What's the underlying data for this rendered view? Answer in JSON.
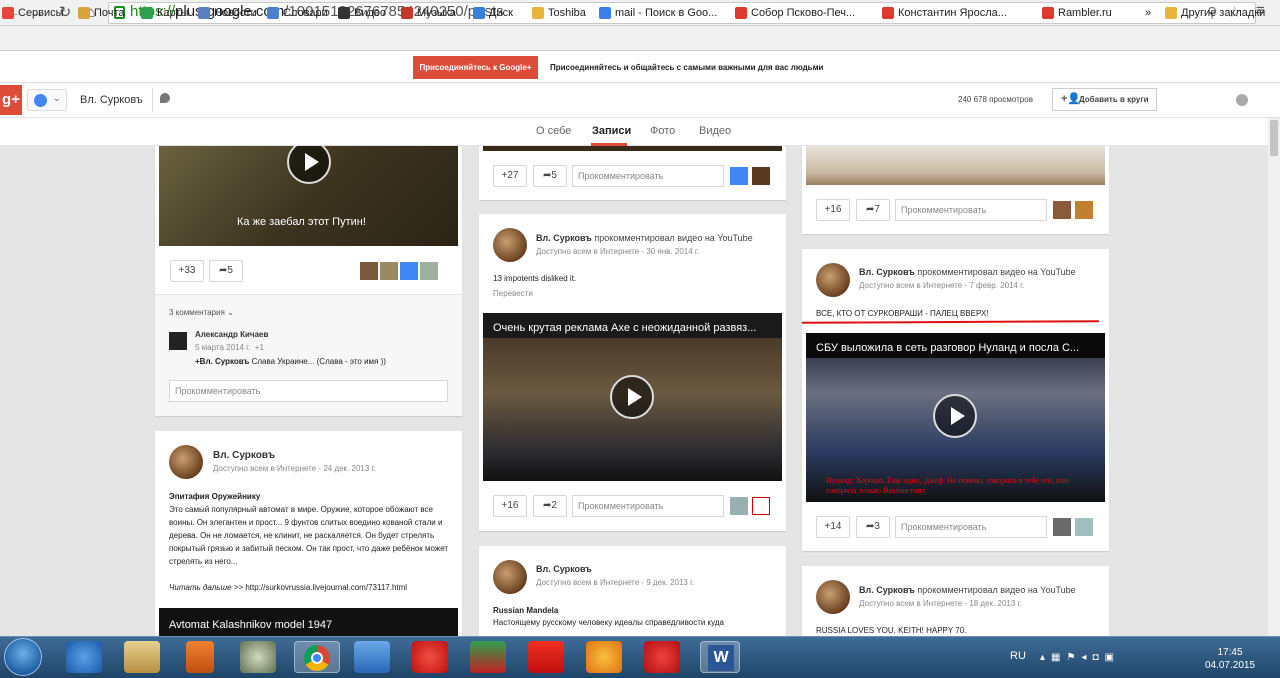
{
  "browser": {
    "url_https": "https://",
    "url_host": "plus.google.com",
    "url_path": "/100151326767854240250/posts",
    "bookmarks": [
      {
        "label": "Сервисы",
        "color": "#e8453c"
      },
      {
        "label": "Почта",
        "color": "#d9a43b"
      },
      {
        "label": "Карты",
        "color": "#2ea14f"
      },
      {
        "label": "Новости",
        "color": "#5b7fbf"
      },
      {
        "label": "Словари",
        "color": "#4a7fd4"
      },
      {
        "label": "Видео",
        "color": "#333333"
      },
      {
        "label": "Музыка",
        "color": "#c0392b"
      },
      {
        "label": "Диск",
        "color": "#3d7fd6"
      },
      {
        "label": "Toshiba",
        "color": "#e8b53c"
      },
      {
        "label": "mail - Поиск в Goo...",
        "color": "#3c7ee8"
      },
      {
        "label": "Собор Псково-Печ...",
        "color": "#e03a2e"
      },
      {
        "label": "Константин Яросла...",
        "color": "#e03a2e"
      },
      {
        "label": "Rambler.ru",
        "color": "#e03a2e"
      }
    ],
    "more_bookmarks": "»",
    "other_bookmarks": "Другие закладки"
  },
  "gplus": {
    "join_button": "Присоединяйтесь к Google+",
    "join_text": "Присоединяйтесь и общайтесь с самыми важными для вас людьми",
    "logo": "g+",
    "profile_name": "Вл. Сурковъ",
    "views": "240 678 просмотров",
    "add_to_circles": "Добавить в круги",
    "tabs": [
      "О себе",
      "Записи",
      "Фото",
      "Видео"
    ]
  },
  "col1": {
    "video1_caption": "Ка же заебал этот Путин!",
    "plus_count": "+33",
    "share_count": "5",
    "comments_count": "3 комментария",
    "commenter": "Александр Кичаев",
    "comment_date": "5 марта 2014 г.",
    "comment_plus": "+1",
    "comment_mention": "+Вл. Сурковъ",
    "comment_text": "Слава Украине... (Слава - это имя ))",
    "comment_placeholder": "Прокомментировать",
    "post2_author": "Вл. Сурковъ",
    "post2_meta": "Доступно всем в Интернете - 24 дек. 2013 г.",
    "post2_title": "Эпитафия Оружейнику",
    "post2_text": "Это самый популярный автомат в мире. Оружие, которое обожают все воины. Он элегантен и прост... 9 фунтов слитых воедино кованой стали и дерева. Он не ломается, не клинит, не раскаляется. Он будет стрелять покрытый грязью и забитый песком. Он так прост, что даже ребёнок может стрелять из него...",
    "read_more": "Читать дальше",
    "read_more_link": ">> http://surkovrussia.livejournal.com/73117.html",
    "post2_video_title": "Avtomat Kalashnikov model 1947"
  },
  "col2": {
    "top_plus": "+27",
    "top_share": "5",
    "comment_placeholder": "Прокомментировать",
    "post1_author": "Вл. Сурковъ",
    "post1_action": "прокомментировал видео на YouTube",
    "post1_meta": "Доступно всем в Интернете - 30 янв. 2014 г.",
    "post1_text": "13 impotents disliked it.",
    "translate": "Перевести",
    "post1_video_title": "Очень крутая реклама Axe с неожиданной развяз...",
    "post1_plus": "+16",
    "post1_share": "2",
    "post2_author": "Вл. Сурковъ",
    "post2_meta": "Доступно всем в Интернете - 9 дек. 2013 г.",
    "post2_title": "Russian Mandela",
    "post2_text": "Настоящему русскому человеку идеалы справедливости куда"
  },
  "col3": {
    "top_plus": "+16",
    "top_share": "7",
    "comment_placeholder": "Прокомментировать",
    "post1_author": "Вл. Сурковъ",
    "post1_action": "прокомментировал видео на YouTube",
    "post1_meta": "Доступно всем в Интернете - 7 февр. 2014 г.",
    "post1_text": "ВСЕ, КТО ОТ СУРКОВРАШИ - ПАЛЕЦ ВВЕРХ!",
    "post1_video_title": "СБУ выложила в сеть разговор Нуланд и посла С...",
    "post1_video_sub": "Нуланд: Хорошо. Еще одно, Джеф. Не помню, говорила я тебе это, или говорила только Вашингтону.",
    "post1_plus": "+14",
    "post1_share": "3",
    "post2_author": "Вл. Сурковъ",
    "post2_action": "прокомментировал видео на YouTube",
    "post2_meta": "Доступно всем в Интернете - 18 дек. 2013 г.",
    "post2_text": "RUSSIA LOVES YOU, KEITH! HAPPY 70."
  },
  "taskbar": {
    "lang": "RU",
    "time": "17:45",
    "date": "04.07.2015"
  }
}
